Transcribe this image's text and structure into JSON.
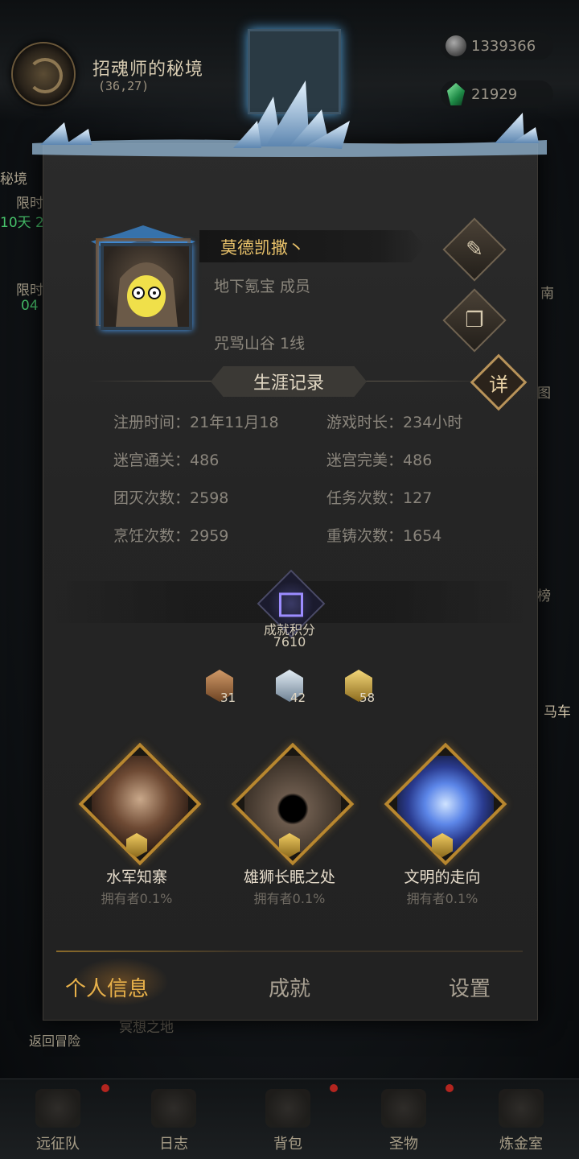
{
  "background": {
    "location_title": "招魂师的秘境",
    "location_coords": "(36,27)",
    "currency_silver": "1339366",
    "currency_gem": "21929",
    "side_left_1": "秘境",
    "side_left_2": "限时",
    "side_left_3": "10天 2",
    "side_left_4": "限时",
    "side_left_5": "04",
    "side_right_1": "南",
    "side_right_2": "图",
    "side_right_3": "榜",
    "side_right_4": "马车",
    "return_label": "返回冒险",
    "bottom_label_hidden": "冥想之地"
  },
  "bottom_nav": [
    {
      "label": "远征队"
    },
    {
      "label": "日志"
    },
    {
      "label": "背包"
    },
    {
      "label": "圣物"
    },
    {
      "label": "炼金室"
    }
  ],
  "profile": {
    "name": "莫德凯撒丶",
    "guild_line": "地下氪宝 成员",
    "server_line": "咒骂山谷 1线",
    "edit_icon": "quill-icon",
    "notes_icon": "scroll-icon"
  },
  "career": {
    "section_title": "生涯记录",
    "detail_label": "详",
    "stats": [
      {
        "label": "注册时间：",
        "value": "21年11月18"
      },
      {
        "label": "游戏时长：",
        "value": "234小时"
      },
      {
        "label": "迷宫通关：",
        "value": "486"
      },
      {
        "label": "迷宫完美：",
        "value": "486"
      },
      {
        "label": "团灭次数：",
        "value": "2598"
      },
      {
        "label": "任务次数：",
        "value": "127"
      },
      {
        "label": "烹饪次数：",
        "value": "2959"
      },
      {
        "label": "重铸次数：",
        "value": "1654"
      }
    ]
  },
  "achievement": {
    "label": "成就积分",
    "score": "7610",
    "medals": [
      {
        "tier": "bronze",
        "count": "31",
        "color": "#b07a4a"
      },
      {
        "tier": "silver",
        "count": "42",
        "color": "#b9c6d2"
      },
      {
        "tier": "gold",
        "count": "58",
        "color": "#d8b34a"
      }
    ],
    "featured": [
      {
        "title": "水军知寨",
        "owner": "拥有者0.1%"
      },
      {
        "title": "雄狮长眠之处",
        "owner": "拥有者0.1%"
      },
      {
        "title": "文明的走向",
        "owner": "拥有者0.1%"
      }
    ]
  },
  "tabs": [
    {
      "label": "个人信息",
      "active": true
    },
    {
      "label": "成就",
      "active": false
    },
    {
      "label": "设置",
      "active": false
    }
  ]
}
